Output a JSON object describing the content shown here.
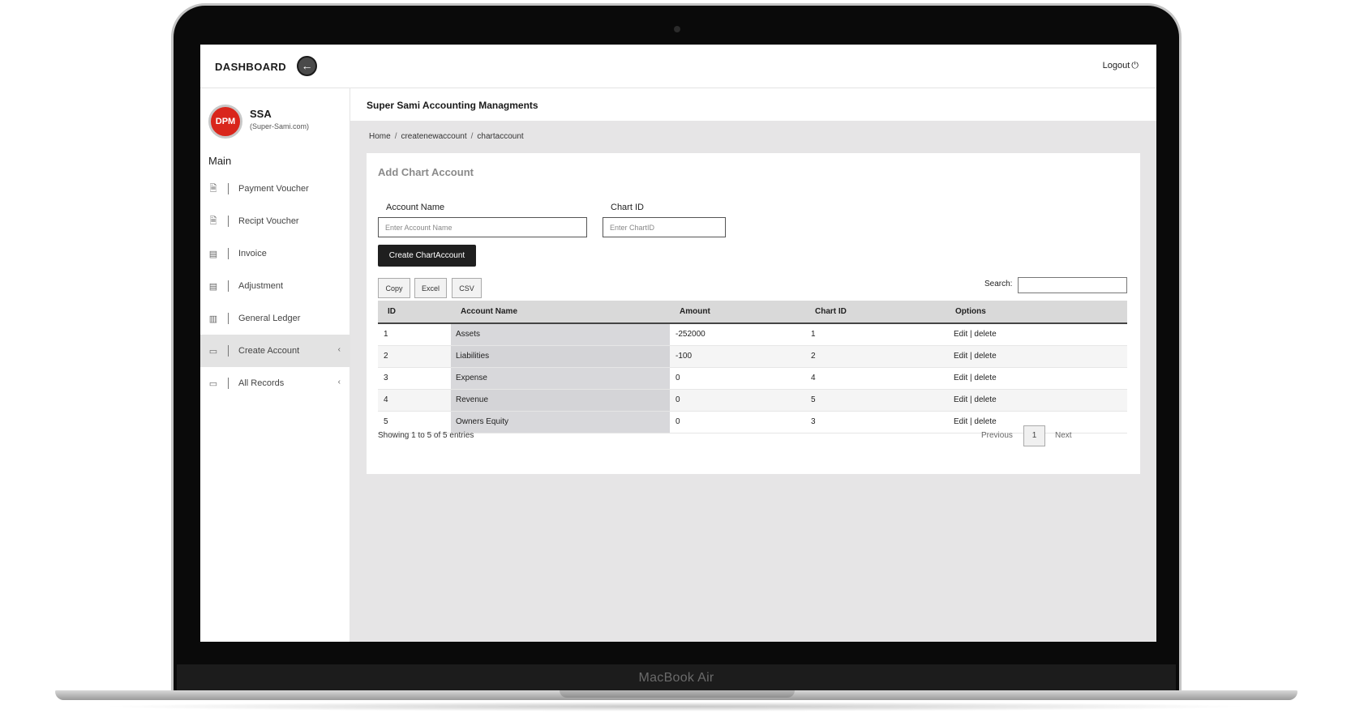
{
  "device": {
    "brand": "MacBook Air"
  },
  "topbar": {
    "title": "DASHBOARD",
    "back_icon": "arrow-left-icon",
    "logout_label": "Logout",
    "logout_icon": "power-icon"
  },
  "sidebar": {
    "org_logo_text": "DPM",
    "org_name": "SSA",
    "org_site": "(Super-Sami.com)",
    "section_label": "Main",
    "items": [
      {
        "label": "Payment Voucher",
        "icon": "document-icon"
      },
      {
        "label": "Recipt Voucher",
        "icon": "document-icon"
      },
      {
        "label": "Invoice",
        "icon": "clipboard-icon"
      },
      {
        "label": "Adjustment",
        "icon": "clipboard-icon"
      },
      {
        "label": "General Ledger",
        "icon": "bar-chart-icon"
      },
      {
        "label": "Create Account",
        "icon": "book-icon",
        "active": true
      },
      {
        "label": "All Records",
        "icon": "book-icon"
      }
    ]
  },
  "content": {
    "title": "Super Sami Accounting Managments",
    "breadcrumb": [
      "Home",
      "createnewaccount",
      "chartaccount"
    ],
    "card_title": "Add Chart Account",
    "form": {
      "account_name_label": "Account Name",
      "account_name_placeholder": "Enter Account Name",
      "account_name_value": "",
      "chart_id_label": "Chart ID",
      "chart_id_placeholder": "Enter ChartID",
      "chart_id_value": "",
      "submit_label": "Create ChartAccount"
    },
    "export_buttons": [
      "Copy",
      "Excel",
      "CSV"
    ],
    "search_label": "Search:",
    "table": {
      "columns": [
        "ID",
        "Account Name",
        "Amount",
        "Chart ID",
        "Options"
      ],
      "rows": [
        {
          "id": "1",
          "name": "Assets",
          "amount": "-252000",
          "chart_id": "1",
          "edit": "Edit",
          "sep": "|",
          "delete": "delete"
        },
        {
          "id": "2",
          "name": "Liabilities",
          "amount": "-100",
          "chart_id": "2",
          "edit": "Edit",
          "sep": "|",
          "delete": "delete"
        },
        {
          "id": "3",
          "name": "Expense",
          "amount": "0",
          "chart_id": "4",
          "edit": "Edit",
          "sep": "|",
          "delete": "delete"
        },
        {
          "id": "4",
          "name": "Revenue",
          "amount": "0",
          "chart_id": "5",
          "edit": "Edit",
          "sep": "|",
          "delete": "delete"
        },
        {
          "id": "5",
          "name": "Owners Equity",
          "amount": "0",
          "chart_id": "3",
          "edit": "Edit",
          "sep": "|",
          "delete": "delete"
        }
      ]
    },
    "info_text": "Showing 1 to 5 of 5 entries",
    "pagination": {
      "previous": "Previous",
      "current_page": "1",
      "next": "Next"
    }
  }
}
